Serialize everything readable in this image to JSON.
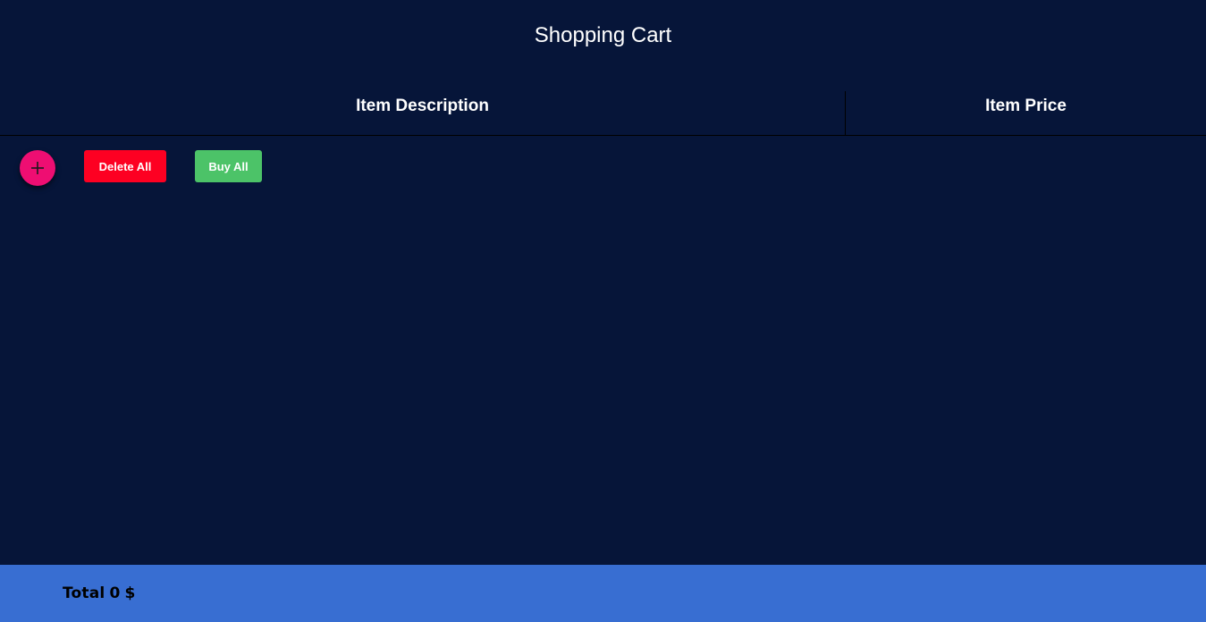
{
  "header": {
    "title": "Shopping Cart"
  },
  "table": {
    "columns": [
      "Item Description",
      "Item Price"
    ],
    "rows": []
  },
  "actions": {
    "add_icon": "plus-icon",
    "delete_all_label": "Delete All",
    "buy_all_label": "Buy All"
  },
  "footer": {
    "total_label": "Total",
    "total_value": "0",
    "currency": "$"
  },
  "colors": {
    "background": "#061539",
    "add_button": "#ee0e72",
    "delete_button": "#fd0022",
    "buy_button": "#4cc368",
    "footer": "#386ed2"
  }
}
